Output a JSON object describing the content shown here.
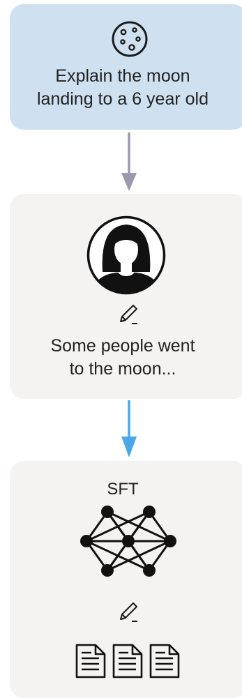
{
  "prompt_card": {
    "icon": "moon-icon",
    "line1": "Explain the moon",
    "line2": "landing to a 6 year old",
    "background": "#cfe1f0"
  },
  "arrow_1": {
    "color": "#9a9aae"
  },
  "human_card": {
    "icon": "person-avatar-icon",
    "edit_icon": "pencil-icon",
    "line1": "Some people went",
    "line2": "to the moon...",
    "background": "#f4f3f1"
  },
  "arrow_2": {
    "color": "#4aa8e8"
  },
  "sft_card": {
    "title": "SFT",
    "icon": "neural-network-icon",
    "edit_icon": "pencil-icon",
    "documents_icon": "document-icon",
    "background": "#f4f3f1"
  }
}
